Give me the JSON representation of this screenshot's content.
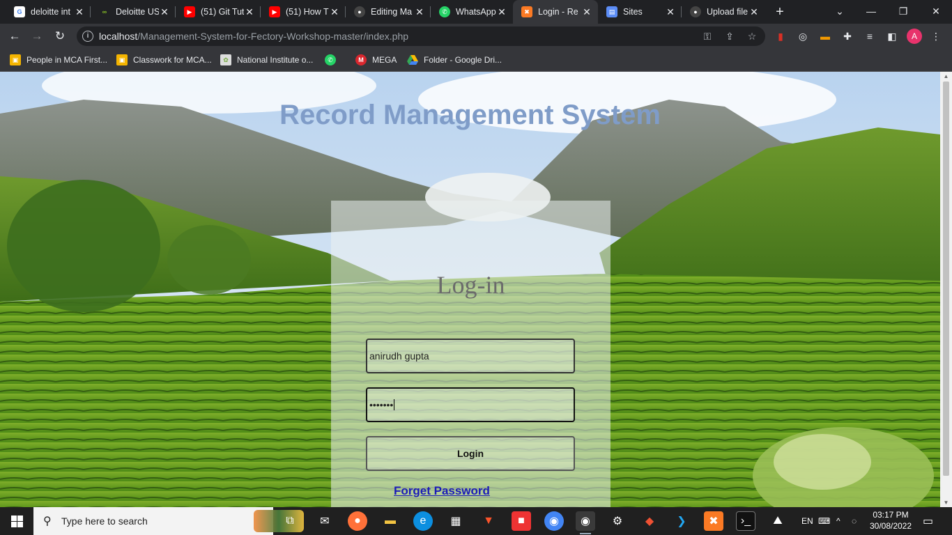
{
  "browser": {
    "tabs": [
      {
        "title": "deloitte int",
        "icon": "google-icon",
        "active": false
      },
      {
        "title": "Deloitte US",
        "icon": "deloitte-icon",
        "active": false
      },
      {
        "title": "(51) Git Tut",
        "icon": "youtube-icon",
        "active": false
      },
      {
        "title": "(51) How T",
        "icon": "youtube-icon",
        "active": false
      },
      {
        "title": "Editing Ma",
        "icon": "github-icon",
        "active": false
      },
      {
        "title": "WhatsApp",
        "icon": "whatsapp-icon",
        "active": false
      },
      {
        "title": "Login - Re",
        "icon": "xampp-icon",
        "active": true
      },
      {
        "title": "Sites",
        "icon": "google-sites-icon",
        "active": false
      },
      {
        "title": "Upload file",
        "icon": "github-icon",
        "active": false
      }
    ],
    "address": {
      "host": "localhost",
      "path": "/Management-System-for-Fectory-Workshop-master/index.php"
    },
    "bookmarks": [
      {
        "label": "People in MCA First...",
        "icon": "classroom-icon"
      },
      {
        "label": "Classwork for MCA...",
        "icon": "classroom-icon"
      },
      {
        "label": "National Institute o...",
        "icon": "nit-icon"
      },
      {
        "label": "",
        "icon": "whatsapp-icon"
      },
      {
        "label": "MEGA",
        "icon": "mega-icon"
      },
      {
        "label": "Folder - Google Dri...",
        "icon": "google-drive-icon"
      }
    ],
    "profile_initial": "A"
  },
  "page": {
    "heading": "Record Management System",
    "login": {
      "title": "Log-in",
      "username_value": "anirudh gupta",
      "password_mask": "•••••••",
      "button_label": "Login",
      "forgot_link": "Forget Password"
    }
  },
  "taskbar": {
    "search_placeholder": "Type here to search",
    "language": "EN",
    "time": "03:17 PM",
    "date": "30/08/2022"
  },
  "colors": {
    "heading": "#7f9cc8",
    "link": "#1a1ab8",
    "avatar": "#e8336c"
  }
}
